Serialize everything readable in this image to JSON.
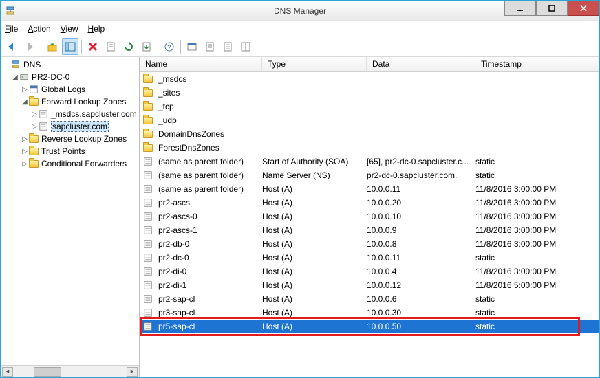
{
  "window": {
    "title": "DNS Manager"
  },
  "menu": {
    "file": "File",
    "action": "Action",
    "view": "View",
    "help": "Help"
  },
  "tree": {
    "root": "DNS",
    "server": "PR2-DC-0",
    "globalLogs": "Global Logs",
    "fwdZones": "Forward Lookup Zones",
    "msdcs": "_msdcs.sapcluster.com",
    "sapcluster": "sapcluster.com",
    "revZones": "Reverse Lookup Zones",
    "trustPoints": "Trust Points",
    "condFwd": "Conditional Forwarders"
  },
  "columns": {
    "name": "Name",
    "type": "Type",
    "data": "Data",
    "timestamp": "Timestamp"
  },
  "folders": [
    {
      "name": "_msdcs"
    },
    {
      "name": "_sites"
    },
    {
      "name": "_tcp"
    },
    {
      "name": "_udp"
    },
    {
      "name": "DomainDnsZones"
    },
    {
      "name": "ForestDnsZones"
    }
  ],
  "records": [
    {
      "name": "(same as parent folder)",
      "type": "Start of Authority (SOA)",
      "data": "[65], pr2-dc-0.sapcluster.c...",
      "ts": "static"
    },
    {
      "name": "(same as parent folder)",
      "type": "Name Server (NS)",
      "data": "pr2-dc-0.sapcluster.com.",
      "ts": "static"
    },
    {
      "name": "(same as parent folder)",
      "type": "Host (A)",
      "data": "10.0.0.11",
      "ts": "11/8/2016 3:00:00 PM"
    },
    {
      "name": "pr2-ascs",
      "type": "Host (A)",
      "data": "10.0.0.20",
      "ts": "11/8/2016 3:00:00 PM"
    },
    {
      "name": "pr2-ascs-0",
      "type": "Host (A)",
      "data": "10.0.0.10",
      "ts": "11/8/2016 3:00:00 PM"
    },
    {
      "name": "pr2-ascs-1",
      "type": "Host (A)",
      "data": "10.0.0.9",
      "ts": "11/8/2016 3:00:00 PM"
    },
    {
      "name": "pr2-db-0",
      "type": "Host (A)",
      "data": "10.0.0.8",
      "ts": "11/8/2016 3:00:00 PM"
    },
    {
      "name": "pr2-dc-0",
      "type": "Host (A)",
      "data": "10.0.0.11",
      "ts": "static"
    },
    {
      "name": "pr2-di-0",
      "type": "Host (A)",
      "data": "10.0.0.4",
      "ts": "11/8/2016 3:00:00 PM"
    },
    {
      "name": "pr2-di-1",
      "type": "Host (A)",
      "data": "10.0.0.12",
      "ts": "11/8/2016 5:00:00 PM"
    },
    {
      "name": "pr2-sap-cl",
      "type": "Host (A)",
      "data": "10.0.0.6",
      "ts": "static"
    },
    {
      "name": "pr3-sap-cl",
      "type": "Host (A)",
      "data": "10.0.0.30",
      "ts": "static"
    },
    {
      "name": "pr5-sap-cl",
      "type": "Host (A)",
      "data": "10.0.0.50",
      "ts": "static",
      "selected": true
    }
  ]
}
